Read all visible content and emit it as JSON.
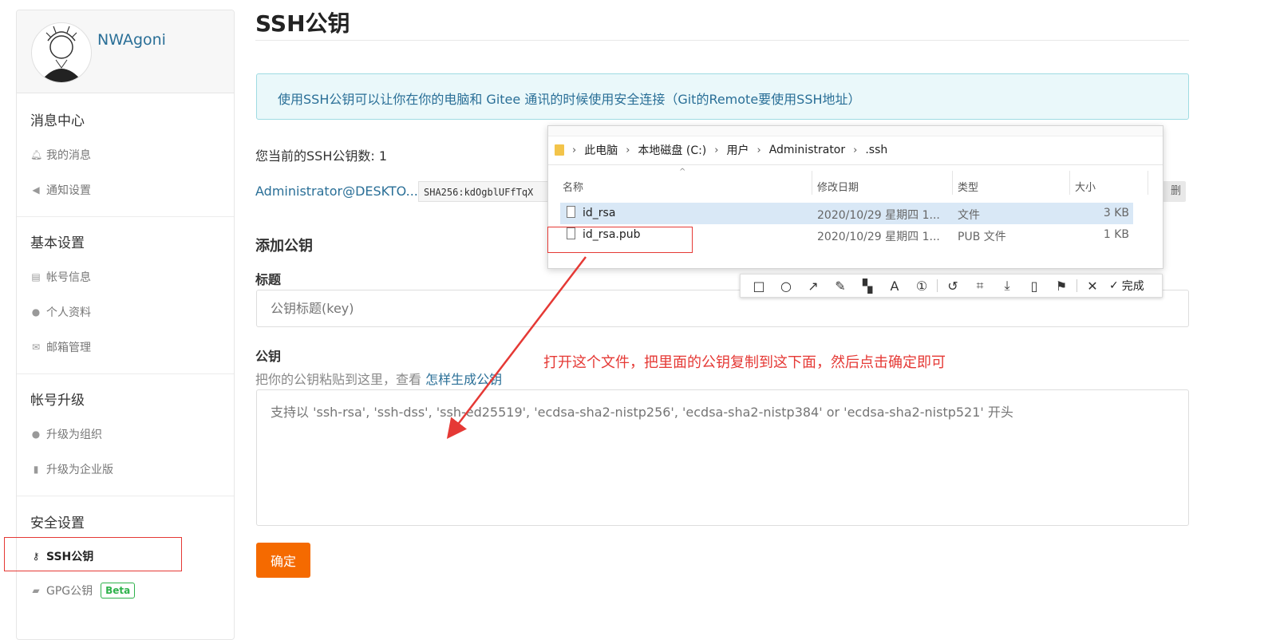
{
  "sidebar": {
    "username": "NWAgoni",
    "sections": [
      {
        "title": "消息中心",
        "items": [
          {
            "label": "我的消息",
            "icon": "bell-icon"
          },
          {
            "label": "通知设置",
            "icon": "speaker-icon"
          }
        ]
      },
      {
        "title": "基本设置",
        "items": [
          {
            "label": "帐号信息",
            "icon": "id-card-icon"
          },
          {
            "label": "个人资料",
            "icon": "user-icon"
          },
          {
            "label": "邮箱管理",
            "icon": "envelope-icon"
          }
        ]
      },
      {
        "title": "帐号升级",
        "items": [
          {
            "label": "升级为组织",
            "icon": "users-icon"
          },
          {
            "label": "升级为企业版",
            "icon": "building-icon"
          }
        ]
      },
      {
        "title": "安全设置",
        "items": [
          {
            "label": "SSH公钥",
            "icon": "key-icon",
            "active": true
          },
          {
            "label": "GPG公钥",
            "icon": "lock-icon",
            "badge": "Beta"
          }
        ]
      }
    ]
  },
  "main": {
    "title": "SSH公钥",
    "info": "使用SSH公钥可以让你在你的电脑和 Gitee 通讯的时候使用安全连接（Git的Remote要使用SSH地址）",
    "count_text": "您当前的SSH公钥数: 1",
    "key": {
      "name": "Administrator@DESKTO...",
      "hash": "SHA256:kdOgblUFfTqX",
      "delete_label": "删除"
    },
    "add_heading": "添加公钥",
    "title_label": "标题",
    "title_placeholder": "公钥标题(key)",
    "pubkey_label": "公钥",
    "hint_prefix": "把你的公钥粘贴到这里，查看 ",
    "hint_link": "怎样生成公钥",
    "pubkey_placeholder": "支持以 'ssh-rsa', 'ssh-dss', 'ssh-ed25519', 'ecdsa-sha2-nistp256', 'ecdsa-sha2-nistp384' or 'ecdsa-sha2-nistp521' 开头",
    "submit_label": "确定"
  },
  "explorer": {
    "breadcrumb": [
      "此电脑",
      "本地磁盘 (C:)",
      "用户",
      "Administrator",
      ".ssh"
    ],
    "columns": {
      "name": "名称",
      "date": "修改日期",
      "type": "类型",
      "size": "大小"
    },
    "files": [
      {
        "name": "id_rsa",
        "date": "2020/10/29 星期四 1...",
        "type": "文件",
        "size": "3 KB",
        "selected": true
      },
      {
        "name": "id_rsa.pub",
        "date": "2020/10/29 星期四 1...",
        "type": "PUB 文件",
        "size": "1 KB",
        "selected": false
      }
    ]
  },
  "snip_toolbar": {
    "tools": [
      "rectangle-icon",
      "ellipse-icon",
      "arrow-icon",
      "pen-icon",
      "mosaic-icon",
      "text-icon",
      "number-icon",
      "undo-icon",
      "ocr-icon",
      "download-icon",
      "pin-icon",
      "bookmark-icon",
      "close-icon"
    ],
    "done_label": "完成"
  },
  "annotation": "打开这个文件，把里面的公钥复制到这下面，然后点击确定即可",
  "colors": {
    "accent": "#f56a00",
    "link": "#2a6f97",
    "annotation": "#e53935",
    "beta": "#2eb24b"
  }
}
